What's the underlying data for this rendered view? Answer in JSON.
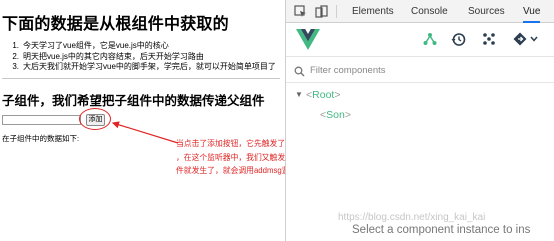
{
  "page": {
    "title": "下面的数据是从根组件中获取的",
    "list": [
      "今天学习了vue组件，它是vue.js中的核心",
      "明天把vue.js中的其它内容结束，后天开始学习路由",
      "大后天我们就开始学习vue中的脚手架，学完后，就可以开始简单项目了"
    ],
    "section_title": "子组件，我们希望把子组件中的数据传递父组件",
    "input_value": "",
    "add_button_label": "添加",
    "received_label": "在子组件中的数据如下:"
  },
  "annotation": {
    "lines": [
      "当点击了添加按钮，它先触发了天然的click事件，click事件发生了，add监听器就调用了",
      "，在这个监听器中，我们又触发了一个自定义事件，叫submitmsg事件，此时submitmsg事",
      "件就发生了，就会调用addmsg监听器"
    ],
    "color": "#e02424"
  },
  "devtools": {
    "tabs": [
      "Elements",
      "Console",
      "Sources",
      "Vue"
    ],
    "active_tab": "Vue",
    "filter_placeholder": "Filter components",
    "tree": [
      {
        "name": "Root",
        "open_bracket": "<",
        "close_bracket": ">",
        "toggle": "▼"
      },
      {
        "name": "Son",
        "open_bracket": "<",
        "close_bracket": ">"
      }
    ],
    "bottom_hint": "Select a component instance to ins",
    "accent_color": "#42b983",
    "icons": [
      "inspect-element-icon",
      "device-toggle-icon",
      "component-tree-icon",
      "history-icon",
      "vuex-icon",
      "routing-icon",
      "vue-logo-icon",
      "search-icon"
    ]
  },
  "watermark": "https://blog.csdn.net/xing_kai_kai"
}
